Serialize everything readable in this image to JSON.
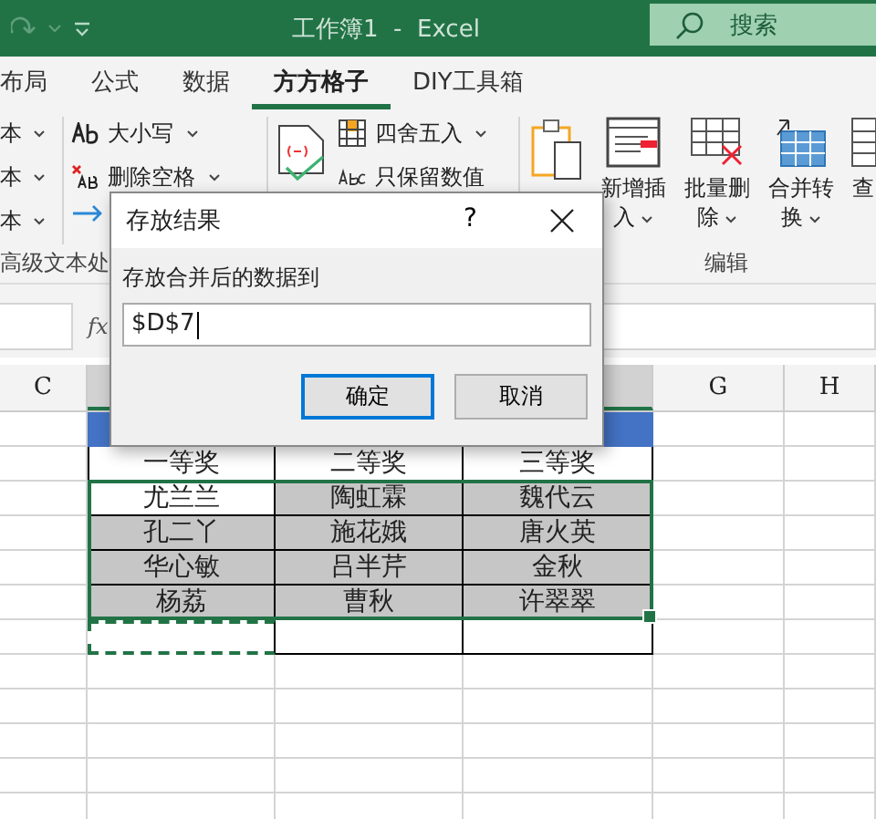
{
  "window": {
    "title": "工作簿1  -  Excel",
    "search_placeholder": "搜索"
  },
  "ribbon": {
    "tabs": [
      {
        "label": "布局",
        "selected": false
      },
      {
        "label": "公式",
        "selected": false
      },
      {
        "label": "数据",
        "selected": false
      },
      {
        "label": "方方格子",
        "selected": true
      },
      {
        "label": "DIY工具箱",
        "selected": false
      }
    ],
    "left_items": [
      "本",
      "本",
      "本"
    ],
    "text_tools": [
      {
        "label": "大小写",
        "kind": "case"
      },
      {
        "label": "删除空格",
        "kind": "trim"
      }
    ],
    "number_tools": [
      {
        "label": "四舍五入",
        "kind": "round"
      },
      {
        "label": "只保留数值",
        "kind": "keep"
      }
    ],
    "big_buttons": [
      {
        "label": "新增插入",
        "kind": "insert"
      },
      {
        "label": "批量删除",
        "kind": "delete"
      },
      {
        "label": "合并转换",
        "kind": "merge"
      },
      {
        "label": "查",
        "kind": "find"
      }
    ],
    "group_labels": [
      "高级文本处",
      "编辑"
    ]
  },
  "formula_bar": {
    "fx": "fx"
  },
  "column_headers": [
    {
      "label": "C"
    },
    {
      "label": "G"
    },
    {
      "label": "H"
    }
  ],
  "table": {
    "rows": [
      {
        "cells": [
          {
            "text": "一等奖",
            "selected": false,
            "active": false,
            "marquee": false
          },
          {
            "text": "二等奖",
            "selected": false,
            "active": false,
            "marquee": false
          },
          {
            "text": "三等奖",
            "selected": false,
            "active": false,
            "marquee": false
          }
        ]
      },
      {
        "cells": [
          {
            "text": "尤兰兰",
            "selected": true,
            "active": true,
            "marquee": false
          },
          {
            "text": "陶虹霖",
            "selected": true,
            "active": false,
            "marquee": false
          },
          {
            "text": "魏代云",
            "selected": true,
            "active": false,
            "marquee": false
          }
        ]
      },
      {
        "cells": [
          {
            "text": "孔二丫",
            "selected": true,
            "active": false,
            "marquee": false
          },
          {
            "text": "施花娥",
            "selected": true,
            "active": false,
            "marquee": false
          },
          {
            "text": "唐火英",
            "selected": true,
            "active": false,
            "marquee": false
          }
        ]
      },
      {
        "cells": [
          {
            "text": "华心敏",
            "selected": true,
            "active": false,
            "marquee": false
          },
          {
            "text": "吕半芹",
            "selected": true,
            "active": false,
            "marquee": false
          },
          {
            "text": "金秋",
            "selected": true,
            "active": false,
            "marquee": false
          }
        ]
      },
      {
        "cells": [
          {
            "text": "杨荔",
            "selected": true,
            "active": false,
            "marquee": false
          },
          {
            "text": "曹秋",
            "selected": true,
            "active": false,
            "marquee": false
          },
          {
            "text": "许翠翠",
            "selected": true,
            "active": false,
            "marquee": false
          }
        ]
      },
      {
        "cells": [
          {
            "text": "",
            "selected": false,
            "active": false,
            "marquee": true
          },
          {
            "text": "",
            "selected": false,
            "active": false,
            "marquee": false
          },
          {
            "text": "",
            "selected": false,
            "active": false,
            "marquee": false
          }
        ]
      }
    ]
  },
  "dialog": {
    "title": "存放结果",
    "help": "?",
    "label": "存放合并后的数据到",
    "value": "$D$7",
    "buttons": [
      {
        "label": "确定",
        "selected": true
      },
      {
        "label": "取消",
        "selected": false
      }
    ]
  }
}
